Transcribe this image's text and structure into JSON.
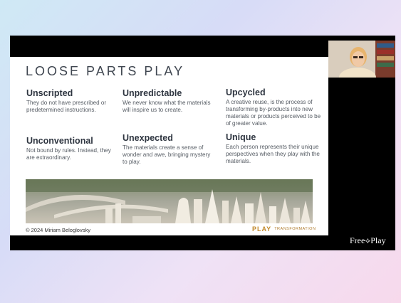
{
  "slide": {
    "title": "LOOSE PARTS PLAY",
    "cards": [
      {
        "heading": "Unscripted",
        "text": "They do not have prescribed or predetermined instructions."
      },
      {
        "heading": "Unpredictable",
        "text": "We never know what the materials will inspire us to create."
      },
      {
        "heading": "Upcycled",
        "text": "A creative reuse, is the process of transforming by-products into new materials or products perceived to be of greater value."
      },
      {
        "heading": "Unconventional",
        "text": "Not bound by rules. Instead, they are extraordinary."
      },
      {
        "heading": "Unexpected",
        "text": "The materials create a sense of wonder and awe, bringing mystery to play."
      },
      {
        "heading": "Unique",
        "text": "Each person represents their unique perspectives when they play with the materials."
      }
    ],
    "copyright": "© 2024 Miriam Beloglovsky",
    "logo_mark": "PLAY",
    "logo_word": "TRANSFORMATION"
  },
  "overlay": {
    "brand": "Free⟡Play"
  }
}
